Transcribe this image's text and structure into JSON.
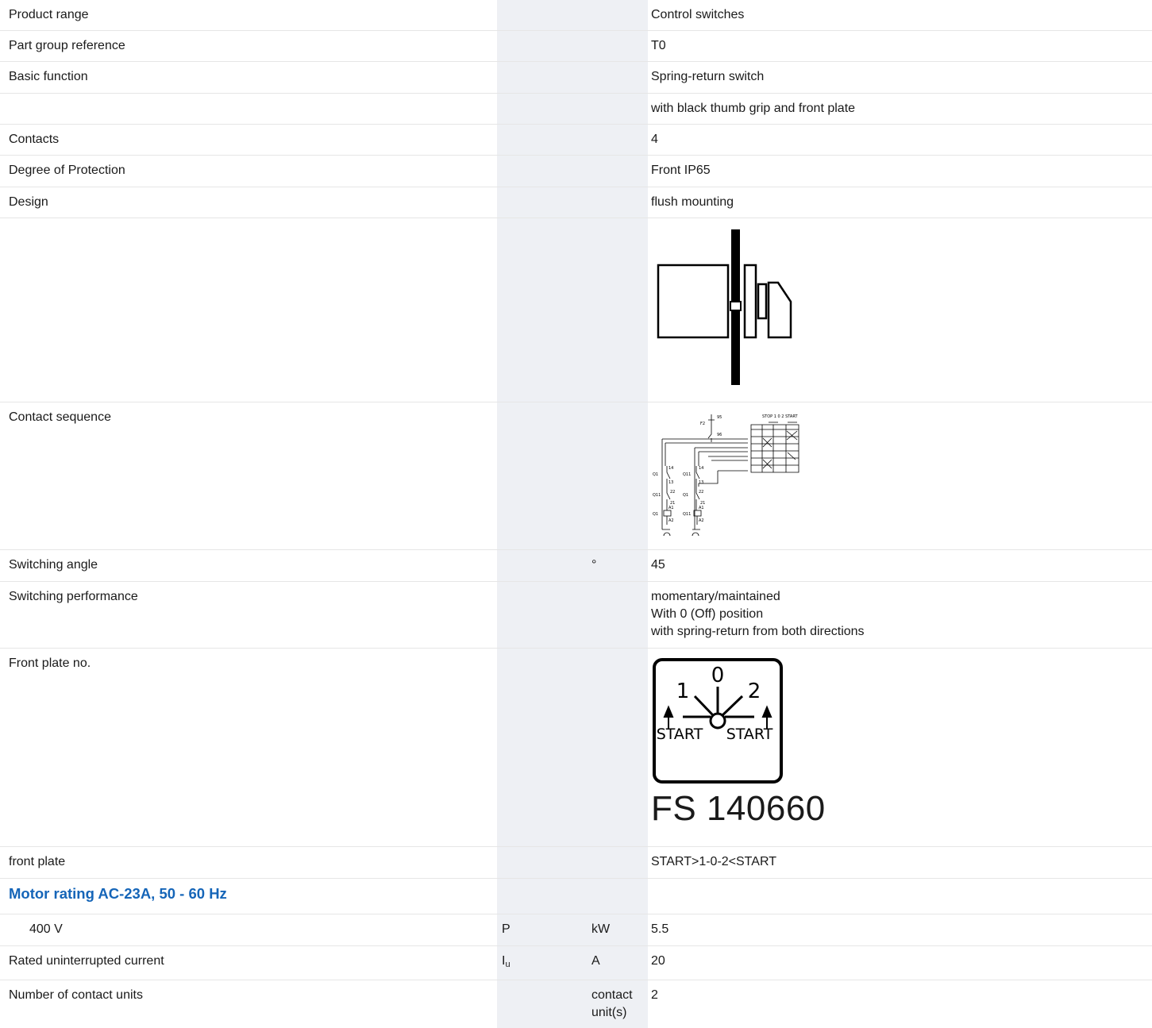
{
  "rows": {
    "product_range": {
      "label": "Product range",
      "value": "Control switches"
    },
    "part_group": {
      "label": "Part group reference",
      "value": "T0"
    },
    "basic_function": {
      "label": "Basic function",
      "value": "Spring-return switch"
    },
    "basic_function_2": {
      "label": "",
      "value": "with black thumb grip and front plate"
    },
    "contacts": {
      "label": "Contacts",
      "value": "4"
    },
    "degree_protection": {
      "label": "Degree of Protection",
      "value": "Front IP65"
    },
    "design": {
      "label": "Design",
      "value": "flush mounting"
    },
    "contact_sequence": {
      "label": "Contact sequence"
    },
    "switching_angle": {
      "label": "Switching angle",
      "unit": "°",
      "value": "45"
    },
    "switching_performance": {
      "label": "Switching performance",
      "values": [
        "momentary/maintained",
        "With 0 (Off) position",
        "with spring-return from both directions"
      ]
    },
    "front_plate_no": {
      "label": "Front plate no.",
      "plate_code": "FS 140660"
    },
    "front_plate": {
      "label": "front plate",
      "value": "START>1-0-2<START"
    },
    "motor_heading": {
      "label": "Motor rating AC-23A, 50 - 60 Hz"
    },
    "voltage_400": {
      "label": "400 V",
      "symbol": "P",
      "unit": "kW",
      "value": "5.5"
    },
    "rated_current": {
      "label": "Rated uninterrupted current",
      "symbol": "I",
      "symbol_sub": "u",
      "unit": "A",
      "value": "20"
    },
    "contact_units": {
      "label": "Number of contact units",
      "unit": "contact unit(s)",
      "value": "2"
    }
  },
  "diagram_text": {
    "plate_one": "1",
    "plate_zero": "0",
    "plate_two": "2",
    "plate_start_left": "START",
    "plate_start_right": "START"
  },
  "icons": [
    "switch-side-view-drawing",
    "contact-sequence-wiring-diagram",
    "front-plate-drawing"
  ]
}
